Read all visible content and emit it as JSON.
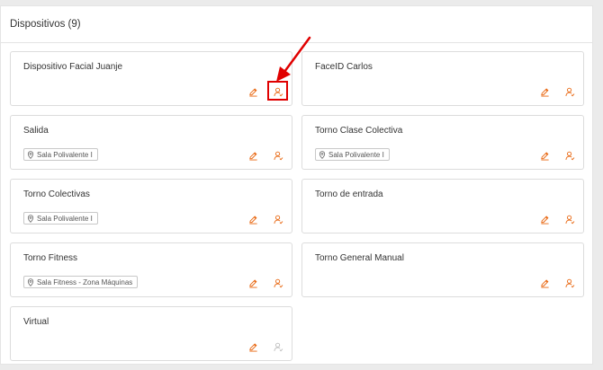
{
  "panel": {
    "title": "Dispositivos (9)"
  },
  "colors": {
    "accent": "#e8650e",
    "disabled": "#bdbdbd",
    "annotation": "#e00000"
  },
  "icons": {
    "edit": "pencil-icon",
    "users": "user-assign-icon",
    "location": "location-pin-icon"
  },
  "devices": [
    {
      "name": "Dispositivo Facial Juanje",
      "location": ""
    },
    {
      "name": "FaceID Carlos",
      "location": ""
    },
    {
      "name": "Salida",
      "location": "Sala Polivalente I"
    },
    {
      "name": "Torno Clase Colectiva",
      "location": "Sala Polivalente I"
    },
    {
      "name": "Torno Colectivas",
      "location": "Sala Polivalente I"
    },
    {
      "name": "Torno de entrada",
      "location": ""
    },
    {
      "name": "Torno Fitness",
      "location": "Sala Fitness - Zona Máquinas"
    },
    {
      "name": "Torno General Manual",
      "location": ""
    },
    {
      "name": "Virtual",
      "location": ""
    }
  ]
}
